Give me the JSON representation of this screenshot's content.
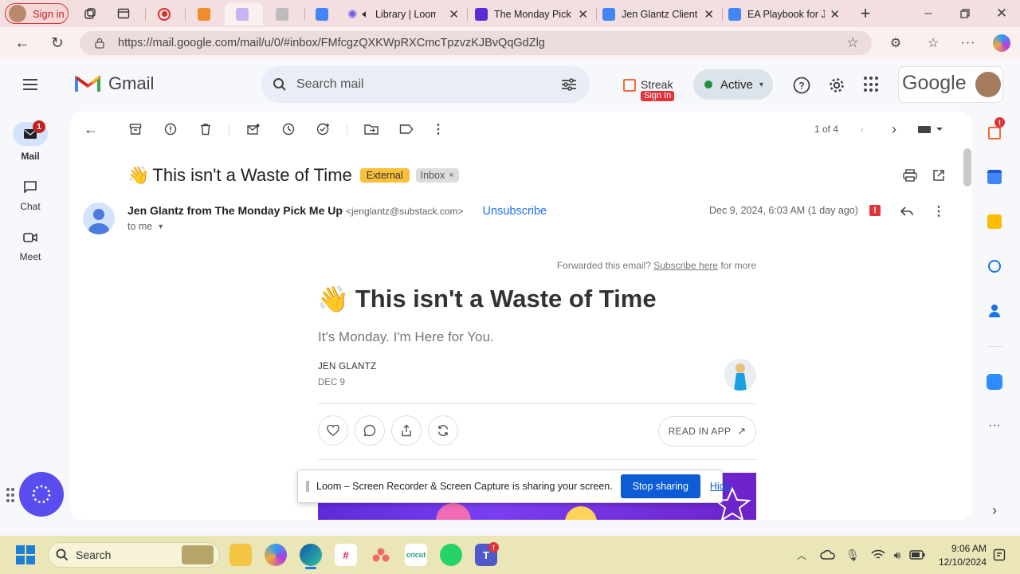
{
  "browser": {
    "profile_button": "Sign in",
    "tabs": [
      {
        "label": ""
      },
      {
        "label": ""
      },
      {
        "label": ""
      },
      {
        "label": ""
      },
      {
        "label": "Library | Loom"
      },
      {
        "label": "The Monday Pick M"
      },
      {
        "label": "Jen Glantz Client P"
      },
      {
        "label": "EA Playbook for Je"
      }
    ],
    "url": "https://mail.google.com/mail/u/0/#inbox/FMfcgzQXKWpRXCmcTpzvzKJBvQqGdZlg"
  },
  "gmail": {
    "logo_text": "Gmail",
    "search_placeholder": "Search mail",
    "streak_label": "Streak",
    "streak_sign_in": "Sign In",
    "status": "Active",
    "google_wordmark": "Google",
    "rail": {
      "mail_label": "Mail",
      "mail_badge": "1",
      "chat_label": "Chat",
      "meet_label": "Meet"
    },
    "pagination": "1 of 4",
    "subject": "This isn't a Waste of Time",
    "subject_emoji": "👋",
    "labels": {
      "external": "External",
      "inbox": "Inbox"
    },
    "sender": {
      "name": "Jen Glantz from The Monday Pick Me Up",
      "email": "<jenglantz@substack.com>",
      "unsubscribe": "Unsubscribe",
      "to": "to me",
      "date": "Dec 9, 2024, 6:03 AM (1 day ago)"
    },
    "right_strip_badge": "!"
  },
  "newsletter": {
    "forward_text": "Forwarded this email?",
    "subscribe_link": "Subscribe here",
    "forward_suffix": "for more",
    "emoji": "👋",
    "title": "This isn't a Waste of Time",
    "subtitle": "It's Monday. I'm Here for You.",
    "author": "JEN GLANTZ",
    "date": "DEC 9",
    "read_in_app": "READ IN APP"
  },
  "loom": {
    "message": "Loom – Screen Recorder & Screen Capture is sharing your screen.",
    "stop_button": "Stop sharing",
    "hide_link": "Hide"
  },
  "taskbar": {
    "search_label": "Search",
    "time": "9:06 AM",
    "date": "12/10/2024"
  },
  "colors": {
    "tab_strip": "#f3dfe0",
    "omnibox": "#ecdcdd",
    "gmail_bg": "#f6f8fc",
    "external_badge": "#f9c13b",
    "link_blue": "#1a73e8",
    "loom_button": "#0b5cd5",
    "taskbar": "#eae6b8"
  }
}
